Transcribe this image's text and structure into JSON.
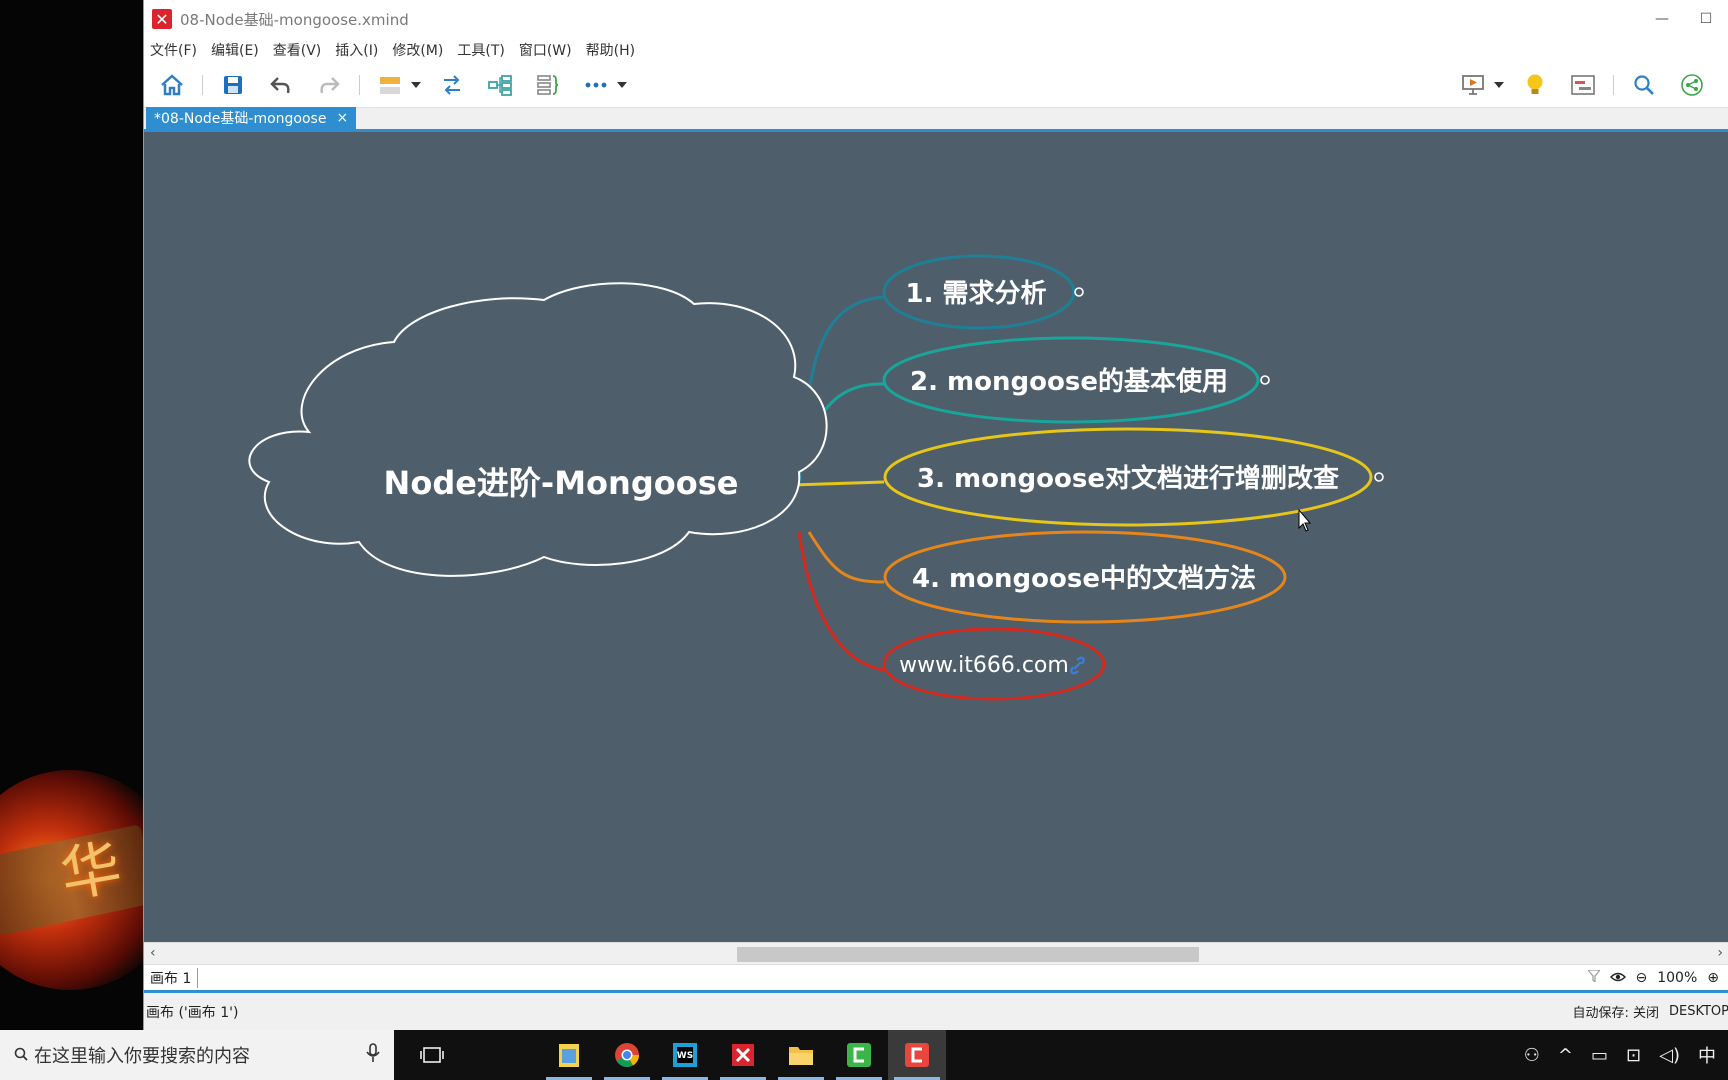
{
  "window": {
    "title": "08-Node基础-mongoose.xmind",
    "app_icon": "xmind-icon"
  },
  "menu": [
    "文件(F)",
    "编辑(E)",
    "查看(V)",
    "插入(I)",
    "修改(M)",
    "工具(T)",
    "窗口(W)",
    "帮助(H)"
  ],
  "tab": {
    "label": "*08-Node基础-mongoose",
    "close": "×"
  },
  "mindmap": {
    "central": "Node进阶-Mongoose",
    "topics": [
      {
        "label": "1. 需求分析",
        "color": "#1f7f96"
      },
      {
        "label": "2. mongoose的基本使用",
        "color": "#1aa59b"
      },
      {
        "label": "3. mongoose对文档进行增删改查",
        "color": "#e6c619"
      },
      {
        "label": "4. mongoose中的文档方法",
        "color": "#e6861a"
      },
      {
        "label": "www.it666.com",
        "color": "#d42a1e"
      }
    ]
  },
  "sheet": {
    "tab_label": "画布 1",
    "zoom": "100%"
  },
  "status": {
    "left": "画布 ('画布 1')",
    "autosave": "自动保存: 关闭",
    "host": "DESKTOP"
  },
  "taskbar": {
    "search_placeholder": "在这里输入你要搜索的内容",
    "ime": "中"
  },
  "colors": {
    "canvas": "#4f5e6b",
    "accent": "#2e8ecf"
  }
}
